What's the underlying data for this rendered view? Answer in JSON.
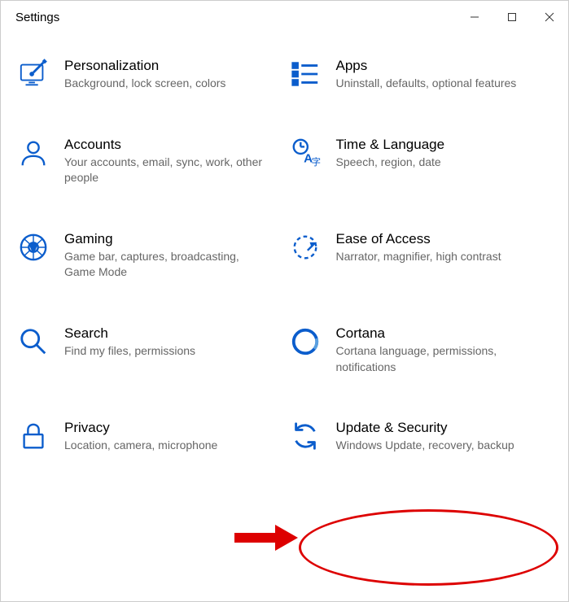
{
  "window": {
    "title": "Settings"
  },
  "items": [
    {
      "title": "Personalization",
      "desc": "Background, lock screen, colors"
    },
    {
      "title": "Apps",
      "desc": "Uninstall, defaults, optional features"
    },
    {
      "title": "Accounts",
      "desc": "Your accounts, email, sync, work, other people"
    },
    {
      "title": "Time & Language",
      "desc": "Speech, region, date"
    },
    {
      "title": "Gaming",
      "desc": "Game bar, captures, broadcasting, Game Mode"
    },
    {
      "title": "Ease of Access",
      "desc": "Narrator, magnifier, high contrast"
    },
    {
      "title": "Search",
      "desc": "Find my files, permissions"
    },
    {
      "title": "Cortana",
      "desc": "Cortana language, permissions, notifications"
    },
    {
      "title": "Privacy",
      "desc": "Location, camera, microphone"
    },
    {
      "title": "Update & Security",
      "desc": "Windows Update, recovery, backup"
    }
  ],
  "colors": {
    "accent": "#0b5dcc"
  }
}
